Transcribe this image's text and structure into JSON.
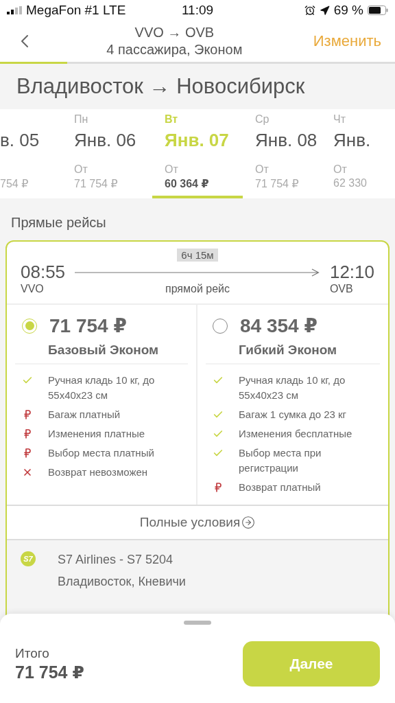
{
  "status_bar": {
    "carrier": "MegaFon #1 LTE",
    "time": "11:09",
    "battery": "69 %"
  },
  "header": {
    "route": "VVO → OVB",
    "subtitle": "4 пассажира, Эконом",
    "action": "Изменить",
    "progress": {
      "level": 0.17
    }
  },
  "title": "Владивосток → Новосибирск",
  "dates": [
    {
      "date": "в. 05",
      "price": "754 ₽",
      "selected": false
    },
    {
      "day": "Пн",
      "date": "Янв. 06",
      "from": "От",
      "price": "71 754 ₽",
      "selected": false
    },
    {
      "day": "Вт",
      "date": "Янв. 07",
      "from": "От",
      "price": "60 364 ₽",
      "selected": true
    },
    {
      "day": "Ср",
      "date": "Янв. 08",
      "from": "От",
      "price": "71 754 ₽",
      "selected": false
    },
    {
      "day": "Чт",
      "date": "Янв.",
      "from": "От",
      "price": "62 330",
      "selected": false
    }
  ],
  "section_title": "Прямые рейсы",
  "flight": {
    "duration": "6ч 15м",
    "depart_time": "08:55",
    "depart_code": "VVO",
    "type": "прямой рейс",
    "arrive_time": "12:10",
    "arrive_code": "OVB",
    "fares": [
      {
        "price": "71 754 ₽",
        "name": "Базовый Эконом",
        "selected": true,
        "features": [
          {
            "kind": "included",
            "text": "Ручная кладь 10 кг, до 55x40x23 см"
          },
          {
            "kind": "paid",
            "text": "Багаж платный"
          },
          {
            "kind": "paid",
            "text": "Изменения платные"
          },
          {
            "kind": "paid",
            "text": "Выбор места платный"
          },
          {
            "kind": "unavailable",
            "text": "Возврат невозможен"
          }
        ]
      },
      {
        "price": "84 354 ₽",
        "name": "Гибкий Эконом",
        "selected": false,
        "features": [
          {
            "kind": "included",
            "text": "Ручная кладь 10 кг, до 55x40x23 см"
          },
          {
            "kind": "included",
            "text": "Багаж 1 сумка до 23 кг"
          },
          {
            "kind": "included",
            "text": "Изменения бесплатные"
          },
          {
            "kind": "included",
            "text": "Выбор места при регистрации"
          },
          {
            "kind": "paid",
            "text": "Возврат платный"
          }
        ]
      }
    ],
    "conditions_link": "Полные условия",
    "airline_logo": "S7",
    "airline": "S7 Airlines - S7 5204",
    "from_airport": "Владивосток, Кневичи"
  },
  "footer": {
    "total_label": "Итого",
    "total": "71 754 ₽",
    "button": "Далее"
  }
}
